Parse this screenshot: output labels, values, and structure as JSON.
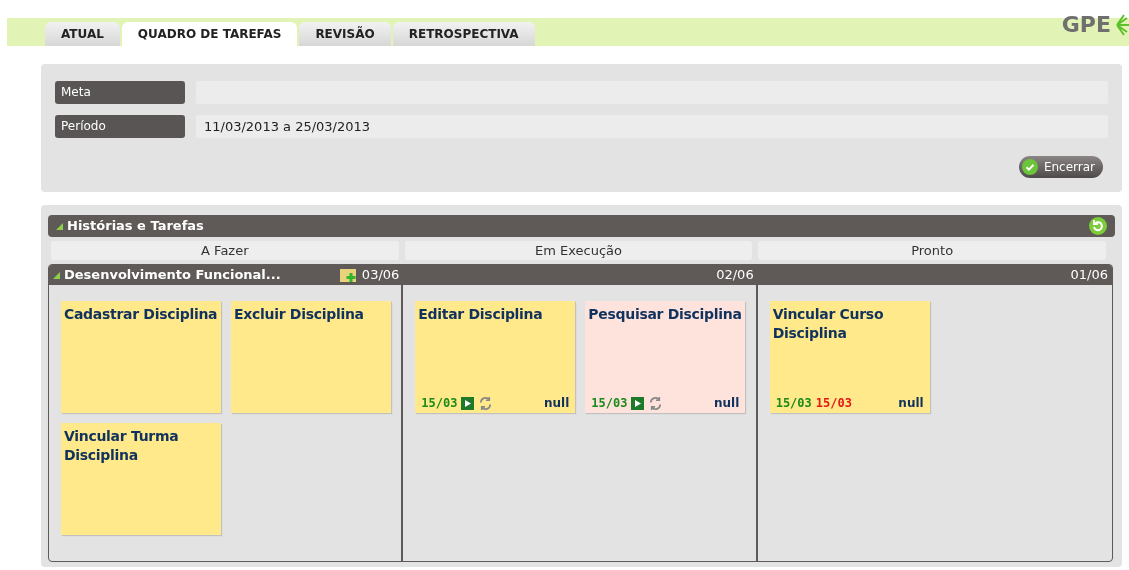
{
  "logo": {
    "text": "GPE"
  },
  "tabs": [
    {
      "label": "ATUAL",
      "selected": false
    },
    {
      "label": "QUADRO DE TAREFAS",
      "selected": true
    },
    {
      "label": "REVISÃO",
      "selected": false
    },
    {
      "label": "RETROSPECTIVA",
      "selected": false
    }
  ],
  "form": {
    "fields": [
      {
        "label": "Meta"
      },
      {
        "label": "Período",
        "value": "11/03/2013 a 25/03/2013"
      }
    ],
    "button": "Encerrar"
  },
  "board": {
    "title": "Histórias e Tarefas",
    "columns": [
      {
        "title": "A Fazer"
      },
      {
        "title": "Em Execução"
      },
      {
        "title": "Pronto"
      }
    ],
    "story": {
      "title": "Desenvolvimento Funcional...",
      "expanded": true,
      "cells": [
        {
          "count": "03/06",
          "cards": [
            {
              "title": "Cadastrar Disciplina",
              "kind": "todo",
              "color": "#ffe98a"
            },
            {
              "title": "Excluir Disciplina",
              "kind": "todo",
              "color": "#ffe98a"
            },
            {
              "title": "Vincular Turma Disciplina",
              "kind": "todo",
              "color": "#ffe98a"
            }
          ]
        },
        {
          "count": "02/06",
          "cards": [
            {
              "title": "Editar Disciplina",
              "kind": "doing",
              "color": "#ffe98a",
              "start": "15/03",
              "owner": "null"
            },
            {
              "title": "Pesquisar Disciplina",
              "kind": "doing",
              "color": "#fde3dc",
              "start": "15/03",
              "owner": "null"
            }
          ]
        },
        {
          "count": "01/06",
          "cards": [
            {
              "title": "Vincular Curso Disciplina",
              "kind": "done",
              "color": "#ffe98a",
              "start": "15/03",
              "end": "15/03",
              "owner": "null"
            }
          ]
        }
      ]
    }
  }
}
